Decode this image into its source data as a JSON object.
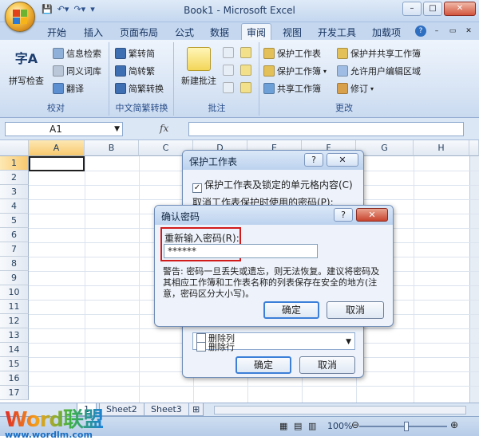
{
  "window": {
    "title": "Book1 - Microsoft Excel"
  },
  "tabs": [
    "开始",
    "插入",
    "页面布局",
    "公式",
    "数据",
    "审阅",
    "视图",
    "开发工具",
    "加载项"
  ],
  "active_tab": "审阅",
  "ribbon": {
    "proofing": {
      "label": "校对",
      "spell_check": "拼写检查",
      "research": "信息检索",
      "thesaurus": "同义词库",
      "translate": "翻译"
    },
    "chinese": {
      "label": "中文简繁转换",
      "to_simplified": "繁转简",
      "to_traditional": "简转繁",
      "convert": "简繁转换"
    },
    "comments": {
      "label": "批注",
      "new_comment": "新建批注"
    },
    "changes": {
      "label": "更改",
      "protect_sheet": "保护工作表",
      "protect_workbook": "保护工作簿",
      "share_workbook": "共享工作簿",
      "protect_share": "保护并共享工作簿",
      "allow_edit": "允许用户编辑区域",
      "track": "修订"
    }
  },
  "formula_bar": {
    "name_box": "A1",
    "fx": "fx"
  },
  "grid": {
    "columns": [
      "A",
      "B",
      "C",
      "D",
      "E",
      "F",
      "G",
      "H"
    ],
    "rows": [
      "1",
      "2",
      "3",
      "4",
      "5",
      "6",
      "7",
      "8",
      "9",
      "10",
      "11",
      "12",
      "13",
      "14",
      "15",
      "16",
      "17"
    ]
  },
  "sheets": [
    "Sheet1",
    "Sheet2",
    "Sheet3"
  ],
  "sheet1_partial": "1",
  "status": {
    "zoom": "100%"
  },
  "watermark": {
    "brand": "Word联盟",
    "url": "www.wordlm.com"
  },
  "protect_dialog": {
    "title": "保护工作表",
    "help": "?",
    "close": "✕",
    "protect_checkbox": "保护工作表及锁定的单元格内容(C)",
    "password_label": "取消工作表保护时使用的密码(P):",
    "list_items": [
      "删除列",
      "删除行"
    ],
    "ok": "确定",
    "cancel": "取消"
  },
  "confirm_dialog": {
    "title": "确认密码",
    "help": "?",
    "close": "✕",
    "reenter_label": "重新输入密码(R):",
    "password_value": "******",
    "warning": "警告: 密码一旦丢失或遗忘，则无法恢复。建议将密码及其相应工作簿和工作表名称的列表保存在安全的地方(注意，密码区分大小写)。",
    "ok": "确定",
    "cancel": "取消"
  },
  "colors": {
    "office_blue": "#c4d7ef",
    "accent_red": "#d11a1a",
    "selection_orange": "#f8c96e"
  }
}
